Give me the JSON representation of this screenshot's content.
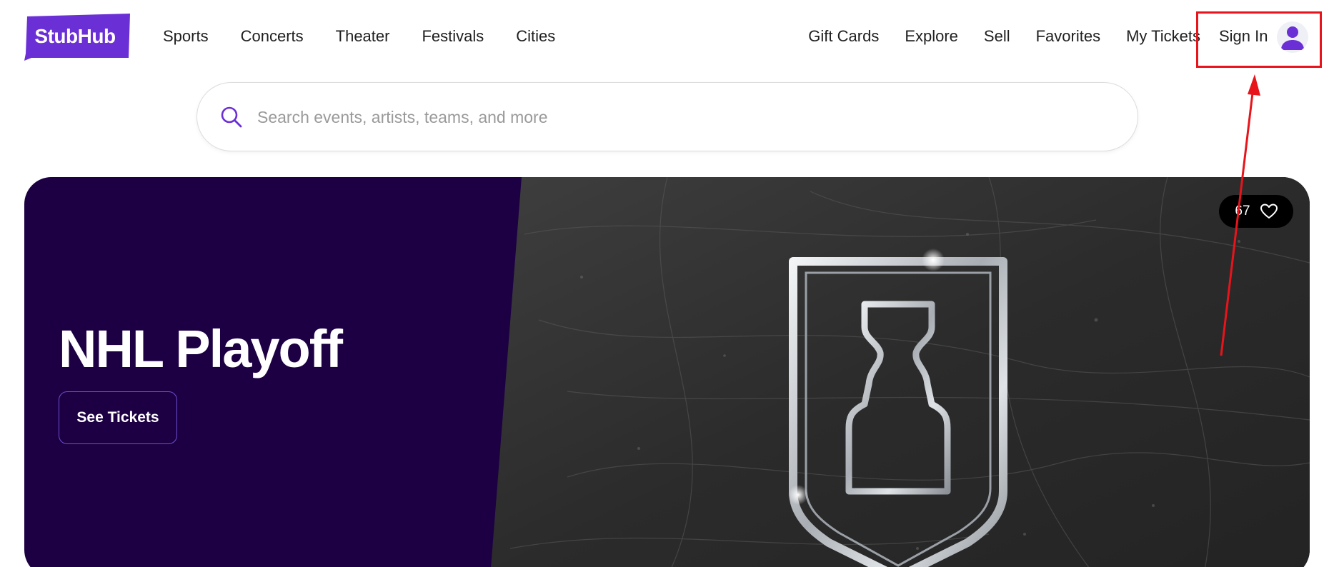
{
  "header": {
    "logo_text": "StubHub",
    "nav_left": [
      "Sports",
      "Concerts",
      "Theater",
      "Festivals",
      "Cities"
    ],
    "nav_right": [
      "Gift Cards",
      "Explore",
      "Sell",
      "Favorites",
      "My Tickets"
    ],
    "signin_label": "Sign In",
    "avatar_icon": "user-avatar-icon"
  },
  "search": {
    "placeholder": "Search events, artists, teams, and more",
    "value": "",
    "icon": "search-icon"
  },
  "hero": {
    "title": "NHL Playoff",
    "cta_label": "See Tickets",
    "favorite_count": "67",
    "favorite_icon": "heart-icon",
    "emblem_icon": "stanley-cup-shield-icon"
  },
  "colors": {
    "brand_purple": "#6b2fd6",
    "hero_bg": "#1c0043",
    "annotation_red": "#e8141b"
  }
}
